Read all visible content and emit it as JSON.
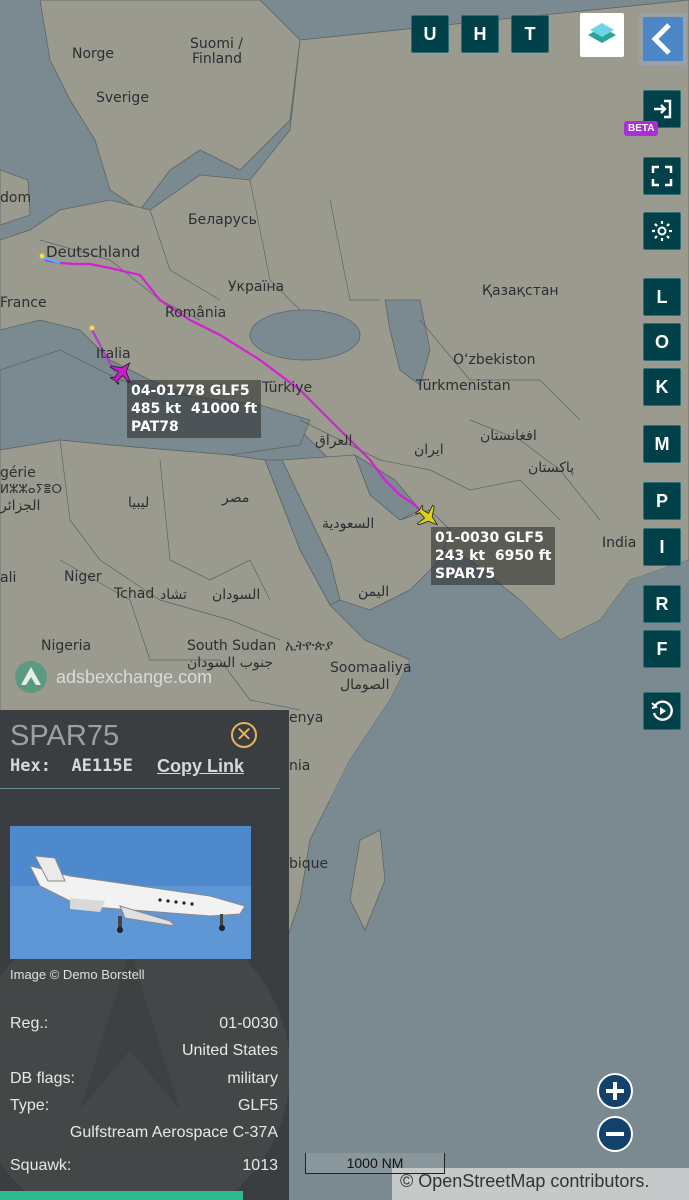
{
  "map": {
    "labels": {
      "norge": "Norge",
      "suomi": "Suomi /",
      "finland": "Finland",
      "sverige": "Sverige",
      "dom": "dom",
      "belarus": "Беларусь",
      "deutschland": "Deutschland",
      "ukraina": "Україна",
      "kazakhstan": "Қазақстан",
      "france": "France",
      "romania": "România",
      "italia": "Italia",
      "uzbekiston": "O‘zbekiston",
      "turkiye": "Türkiye",
      "turkmenistan": "Türkmenistan",
      "afghanistan": "افغانستان",
      "iraq": "العراق",
      "iran": "ایران",
      "pakistan": "پاکستان",
      "algerie": "gérie",
      "algerie_berber": "ⵍⵣⵣⴰⵢⴻⵔ",
      "algerie_ar": "الجزائر",
      "libya": "ليبيا",
      "misr": "مصر",
      "saudi": "السعودية",
      "india": "India",
      "mali": "ali",
      "niger": "Niger",
      "tchad": "Tchad",
      "tchad_ar": "تشاد",
      "sudan": "السودان",
      "yemen": "اليمن",
      "nigeria": "Nigeria",
      "south_sudan": "South Sudan",
      "south_sudan_ar": "جنوب السودان",
      "ethiopia": "ኢትዮጵያ",
      "somalia": "Soomaaliya",
      "somalia_ar": "الصومال",
      "kenya": "enya",
      "nia": "nia",
      "bique": "bique"
    },
    "brand": "adsbexchange.com",
    "scale": "1000 NM",
    "attribution": "© OpenStreetMap contributors."
  },
  "top_buttons": [
    "U",
    "H",
    "T"
  ],
  "side_buttons": [
    "L",
    "O",
    "K",
    "M",
    "P",
    "I",
    "R",
    "F"
  ],
  "beta_badge": "BETA",
  "aircraft": [
    {
      "line1": "04-01778 GLF5",
      "line2": "485 kt  41000 ft",
      "line3": "PAT78",
      "color": "#c81ec8"
    },
    {
      "line1": "01-0030 GLF5",
      "line2": "243 kt  6950 ft",
      "line3": "SPAR75",
      "color": "#d9d21a"
    }
  ],
  "panel": {
    "callsign": "SPAR75",
    "hex_label": "Hex:",
    "hex_value": "AE115E",
    "copy_link": "Copy Link",
    "image_credit": "Image © Demo Borstell",
    "rows": [
      {
        "key": "Reg.:",
        "value": "01-0030"
      },
      {
        "key": "",
        "value": "United States"
      },
      {
        "key": "DB flags:",
        "value": "military"
      },
      {
        "key": "Type:",
        "value": "GLF5"
      },
      {
        "key": "",
        "value": "Gulfstream Aerospace C-37A"
      },
      {
        "key": "Squawk:",
        "value": "1013"
      }
    ]
  },
  "colors": {
    "water": "#7a8a90",
    "land": "#9a9a8f",
    "button_bg": "#004049",
    "track_primary": "#d51fd6",
    "panel_bg": "#3b3e40"
  }
}
